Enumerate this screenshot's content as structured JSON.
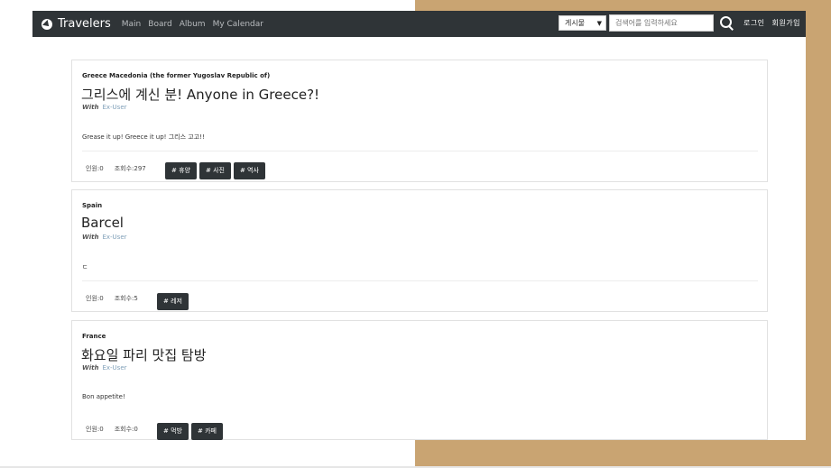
{
  "nav": {
    "brand": "Travelers",
    "links": [
      "Main",
      "Board",
      "Album",
      "My Calendar"
    ],
    "select_value": "게시물",
    "search_placeholder": "검색어를 입력하세요",
    "login": "로그인",
    "signup": "회원가입"
  },
  "posts": [
    {
      "country": "Greece Macedonia (the former Yugoslav Republic of)",
      "title": "그리스에 계신 분! Anyone in Greece?!",
      "with_label": "With",
      "with_user": "Ex-User",
      "body": "Grease it up! Greece it up! 그리스 고고!!",
      "people": "인원:0",
      "views": "조회수:297",
      "tags": [
        "# 휴양",
        "# 사진",
        "# 역사"
      ]
    },
    {
      "country": "Spain",
      "title": "Barcel",
      "with_label": "With",
      "with_user": "Ex-User",
      "body": "ㄷ",
      "people": "인원:0",
      "views": "조회수:5",
      "tags": [
        "# 레저"
      ]
    },
    {
      "country": "France",
      "title": "화요일 파리 맛집 탐방",
      "with_label": "With",
      "with_user": "Ex-User",
      "body": "Bon appetite!",
      "people": "인원:0",
      "views": "조회수:0",
      "tags": [
        "# 먹방",
        "# 카페"
      ]
    }
  ]
}
